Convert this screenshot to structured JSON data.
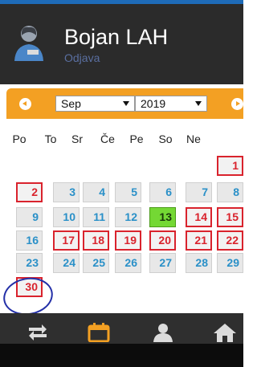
{
  "header": {
    "user_name": "Bojan LAH",
    "logout_label": "Odjava"
  },
  "calendar": {
    "month": "Sep",
    "year": "2019",
    "weekdays": [
      "Po",
      "To",
      "Sr",
      "Če",
      "Pe",
      "So",
      "Ne"
    ],
    "days": [
      "1",
      "2",
      "3",
      "4",
      "5",
      "6",
      "7",
      "8",
      "9",
      "10",
      "11",
      "12",
      "13",
      "14",
      "15",
      "16",
      "17",
      "18",
      "19",
      "20",
      "21",
      "22",
      "23",
      "24",
      "25",
      "26",
      "27",
      "28",
      "29",
      "30"
    ]
  },
  "toolbar": {
    "icons": [
      "sync-icon",
      "calendar-icon",
      "user-icon",
      "home-icon"
    ]
  },
  "colors": {
    "accent": "#f3a023",
    "highlight": "#d9232d",
    "today": "#74d834",
    "day_text": "#2a90c8"
  }
}
